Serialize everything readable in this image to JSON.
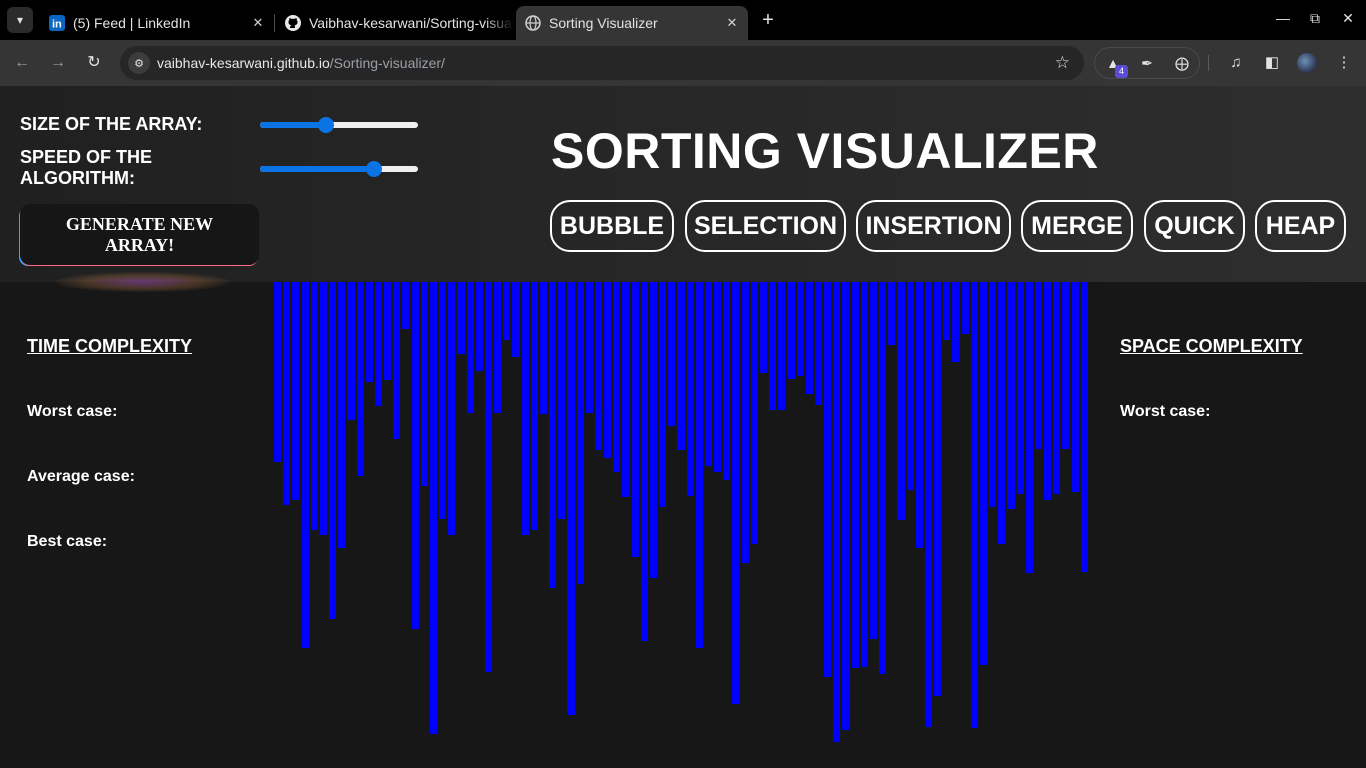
{
  "browser": {
    "tabs": [
      {
        "title": "(5) Feed | LinkedIn",
        "icon": "linkedin-icon",
        "active": false
      },
      {
        "title": "Vaibhav-kesarwani/Sorting-visualizer",
        "icon": "github-icon",
        "active": false
      },
      {
        "title": "Sorting Visualizer",
        "icon": "globe-icon",
        "active": true
      }
    ],
    "url_domain": "vaibhav-kesarwani.github.io",
    "url_path": "/Sorting-visualizer/",
    "extension_badge": "4"
  },
  "controls": {
    "size_label": "SIZE OF THE ARRAY:",
    "size_slider_level": 0.42,
    "speed_label": "SPEED OF THE ALGORITHM:",
    "speed_slider_level": 0.72,
    "generate_label": "GENERATE NEW ARRAY!"
  },
  "title": "SORTING VISUALIZER",
  "algorithms": [
    {
      "label": "BUBBLE"
    },
    {
      "label": "SELECTION"
    },
    {
      "label": "INSERTION"
    },
    {
      "label": "MERGE"
    },
    {
      "label": "QUICK"
    },
    {
      "label": "HEAP"
    }
  ],
  "time_complexity": {
    "title": "TIME COMPLEXITY",
    "worst": "Worst case:",
    "average": "Average case:",
    "best": "Best case:"
  },
  "space_complexity": {
    "title": "SPACE COMPLEXITY",
    "worst": "Worst case:"
  },
  "colors": {
    "bar": "#0000ff",
    "slider_accent": "#0b74e5",
    "background": "#171717"
  },
  "array": {
    "values": [
      180,
      223,
      218,
      366,
      248,
      253,
      337,
      266,
      138,
      194,
      100,
      124,
      98,
      157,
      47,
      347,
      204,
      452,
      237,
      253,
      72,
      131,
      89,
      390,
      131,
      58,
      75,
      253,
      248,
      132,
      306,
      237,
      433,
      302,
      131,
      168,
      176,
      190,
      215,
      275,
      359,
      296,
      225,
      144,
      168,
      214,
      366,
      184,
      190,
      198,
      422,
      281,
      262,
      91,
      128,
      128,
      97,
      94,
      112,
      123,
      395,
      652,
      448,
      386,
      385,
      357,
      392,
      63,
      238,
      208,
      266,
      445,
      414,
      58,
      80,
      52,
      446,
      383,
      225,
      262,
      227,
      212,
      291,
      167,
      218,
      212,
      167,
      210,
      290
    ]
  }
}
